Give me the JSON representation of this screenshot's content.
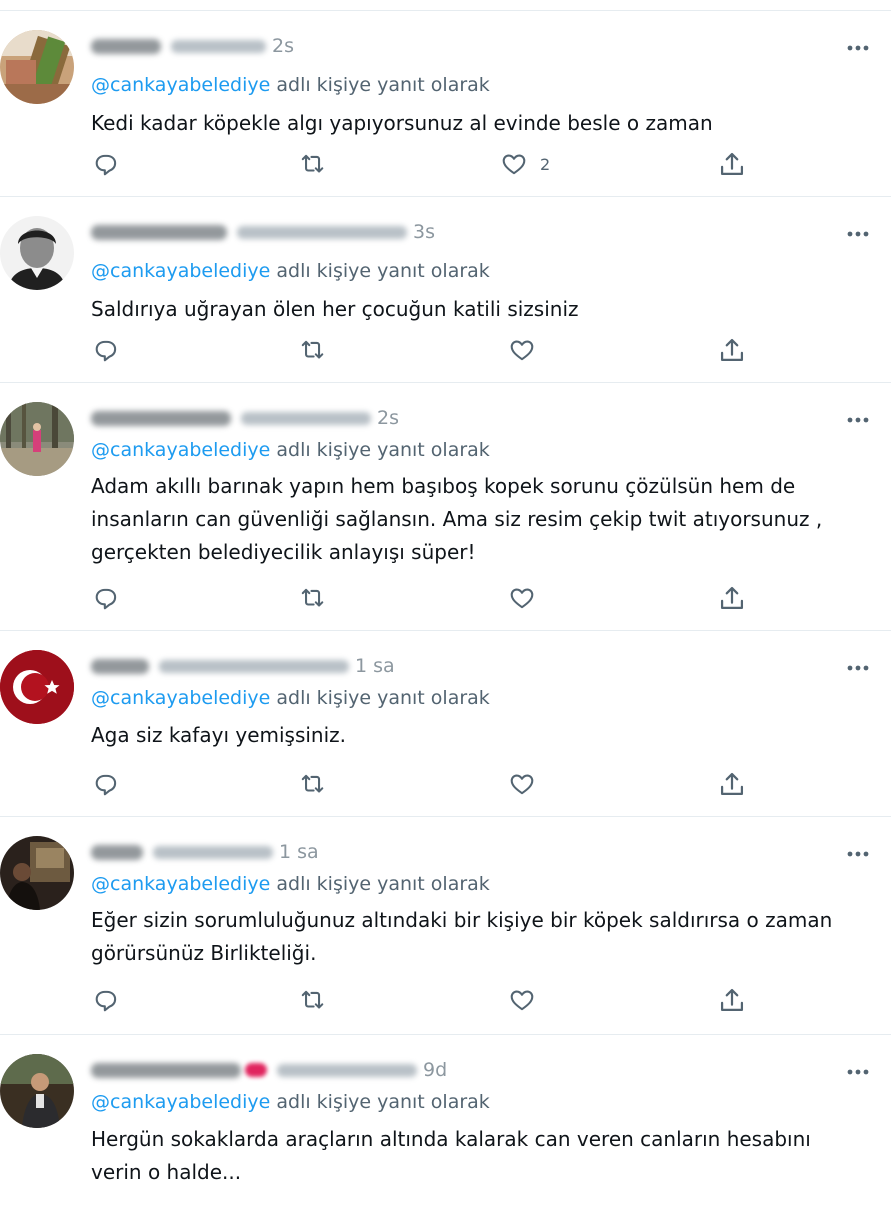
{
  "feed": {
    "mention": "@cankayabelediye",
    "reply_suffix": " adlı kişiye yanıt olarak",
    "tweets": [
      {
        "time": "2s",
        "text": "Kedi kadar köpekle algı yapıyorsunuz al evinde besle o zaman",
        "like_count": "2"
      },
      {
        "time": "3s",
        "text": "Saldırıya uğrayan ölen her çocuğun katili sizsiniz",
        "like_count": ""
      },
      {
        "time": "2s",
        "text": "Adam akıllı barınak yapın hem başıboş kopek sorunu çözülsün hem de\ninsanların can güvenliği sağlansın. Ama siz resim çekip twit atıyorsunuz ,\ngerçekten belediyecilik anlayışı süper!",
        "like_count": ""
      },
      {
        "time": "1 sa",
        "text": "Aga siz kafayı yemişsiniz.",
        "like_count": ""
      },
      {
        "time": "1 sa",
        "text": "Eğer sizin sorumluluğunuz altındaki bir kişiye bir köpek saldırırsa o zaman\ngörürsünüz Birlikteliği.",
        "like_count": ""
      },
      {
        "time": "9d",
        "text": "Hergün sokaklarda araçların altında kalarak can veren canların hesabını\nverin o halde...",
        "like_count": ""
      }
    ]
  },
  "icons": {
    "reply": "reply-icon",
    "retweet": "retweet-icon",
    "like": "heart-icon",
    "share": "share-icon",
    "more": "more-icon"
  },
  "colors": {
    "mention": "#1d9bf0",
    "icon": "#536471",
    "divider": "#e6ecf0",
    "time": "#8c979f"
  }
}
